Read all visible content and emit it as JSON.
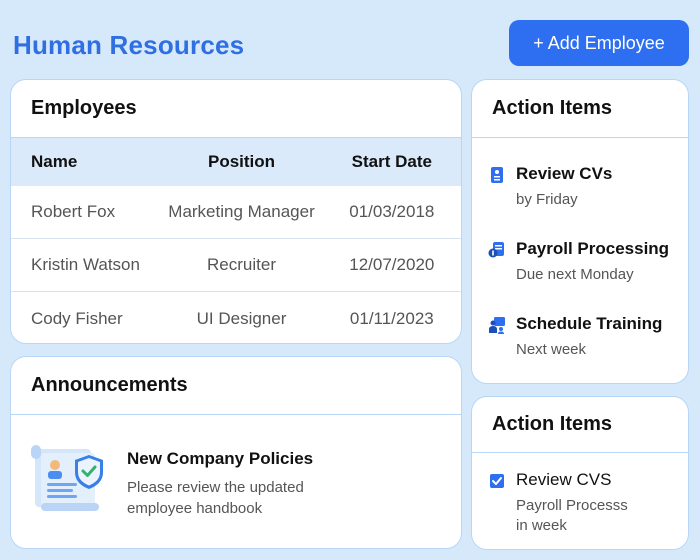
{
  "header": {
    "title": "Human Resources",
    "add_button_icon": "plus-icon",
    "add_button_label": "+ Add Employee"
  },
  "employees": {
    "title": "Employees",
    "columns": [
      "Name",
      "Position",
      "Start Date"
    ],
    "rows": [
      {
        "name": "Robert Fox",
        "position": "Marketing Manager",
        "start_date": "01/03/2018"
      },
      {
        "name": "Kristin Watson",
        "position": "Recruiter",
        "start_date": "12/07/2020"
      },
      {
        "name": "Cody Fisher",
        "position": "UI Designer",
        "start_date": "01/11/2023"
      }
    ]
  },
  "announcements": {
    "title": "Announcements",
    "item": {
      "icon": "policy-document-shield-icon",
      "title": "New Company Policies",
      "description_line1": "Please review the updated",
      "description_line2": "employee handbook"
    }
  },
  "action_items_1": {
    "title": "Action Items",
    "items": [
      {
        "icon": "document-icon",
        "title": "Review CVs",
        "subtitle": "by Friday"
      },
      {
        "icon": "payroll-icon",
        "title": "Payroll Processing",
        "subtitle": "Due next Monday"
      },
      {
        "icon": "training-icon",
        "title": "Schedule Training",
        "subtitle": "Next week"
      }
    ]
  },
  "action_items_2": {
    "title": "Action Items",
    "item": {
      "icon": "checkbox-checked-icon",
      "title": "Review CVS",
      "subtitle_line1": "Payroll Processs",
      "subtitle_line2": "in week"
    }
  },
  "colors": {
    "background": "#d6e9fb",
    "accent": "#2d6ff0",
    "title": "#2f6fe3",
    "table_header": "#dbeafb",
    "border": "#b8d6f5"
  }
}
